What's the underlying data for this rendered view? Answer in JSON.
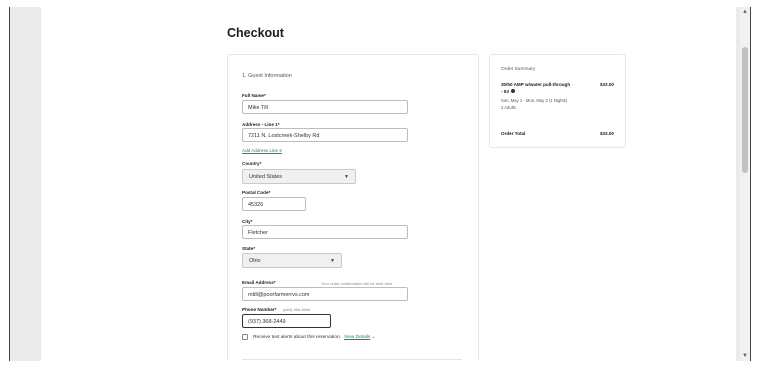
{
  "page": {
    "title": "Checkout"
  },
  "guest_info": {
    "section_title": "1. Guest Information",
    "full_name": {
      "label": "Full Name*",
      "value": "Mike Till"
    },
    "address1": {
      "label": "Address - Line 1*",
      "value": "7211 N. Lostcreek-Shelby Rd"
    },
    "add_address_link": "Add Address Line 2",
    "country": {
      "label": "Country*",
      "value": "United States"
    },
    "postal": {
      "label": "Postal Code*",
      "value": "45326"
    },
    "city": {
      "label": "City*",
      "value": "Fletcher"
    },
    "state": {
      "label": "State*",
      "value": "Ohio"
    },
    "email": {
      "label": "Email Address*",
      "hint": "Your order confirmation will be sent here",
      "value": "mtill@poorfarmerrvs.com"
    },
    "phone": {
      "label": "Phone Number*",
      "hint": "(###) ###-####",
      "value": "(937) 368-2449"
    },
    "text_alerts": {
      "label": "Receive text alerts about this reservation.",
      "link": "View Details"
    }
  },
  "order_summary": {
    "title": "Order Summary",
    "item_name": "30/50 AMP w/water pull-through - 53",
    "item_price": "$33.00",
    "item_dates": "Sun, May 1 - Mon, May 2 (1 Nights)",
    "item_guests": "2 Adults",
    "total_label": "Order Total",
    "total_value": "$33.00"
  },
  "colors": {
    "link_green": "#1a8a5a",
    "background": "#ebebeb"
  },
  "icons": [
    "info-icon",
    "chevron-down-icon",
    "checkbox-icon"
  ]
}
